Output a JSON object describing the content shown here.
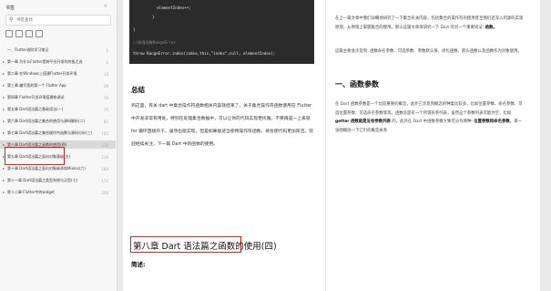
{
  "sidebar": {
    "title": "书签",
    "close": "×",
    "search_placeholder": "书签查找",
    "items": [
      {
        "label": "一、Flutter进阶学习笔记",
        "page": "1"
      },
      {
        "label": "第一章 为什么Flutter是跨平台开发的终极之选",
        "page": "2"
      },
      {
        "label": "第二章 在Windows上搭建Flutter开发环境",
        "page": "13"
      },
      {
        "label": "第三章 编写您的第一个 Flutter App",
        "page": "28"
      },
      {
        "label": "第四章 Flutter开发环境搭建和调试",
        "page": "70"
      },
      {
        "label": "第五章 Dart语法篇之基础语法(一)",
        "page": "75"
      },
      {
        "label": "第六章 Dart语法篇之集合的使用与源码解析(二)",
        "page": "82"
      },
      {
        "label": "第七章 Dart语法篇之集合操作符函数与源码分析(三)",
        "page": "105"
      },
      {
        "label": "第八章 Dart语法篇之函数的使用(四)",
        "page": "128"
      },
      {
        "label": "第九章 Dart语法篇之面向对象基础(五)",
        "page": "139"
      },
      {
        "label": "第十章 Dart语法篇之面向对象继承和Mixins(六)",
        "page": "160"
      },
      {
        "label": "第十一章 Dart语法篇之类型系统与泛型(七)",
        "page": "172"
      },
      {
        "label": "第十二章 Flutter中的widget",
        "page": "200"
      }
    ]
  },
  "code": {
    "line1": "    elementIndex++;",
    "line2": "  }",
    "line3": "}",
    "line4": "//调用函数RangeError",
    "line5": "throw RangeError.index(index,this,\"index\",null, elementIndex);"
  },
  "left_page": {
    "summary_heading": "总结",
    "summary_text": "到这里，有关 dart 中集合操作符函数相关内容就结束了，关于集合操作符函数使用在 Flutter 中开发非常有用处，特别在处理集合数据中，可以让你的代码实现更优雅，不要再是一上来就 for 循环直接开干，虽然也能实现，但是如果能适当使用操作符函数，将会使代码更加简洁。欢迎继续关注，下一篇 Dart 中的函数的使用。",
    "chapter_title": "第八章 Dart 语法篇之函数的使用(四)",
    "brief_heading": "简述:"
  },
  "right_page": {
    "para1": "在上一篇文章中我们详细地研究了一下集合有关内容，包括集合的操作符的使用甚至我们还深入到源码实现原理，从原理上掌握集合的使用。那么这篇文章来研究一下 Dart 的另一个重要语法: ",
    "para1_bold": "函数。",
    "para2": "这篇主要会涉及到: 函数命名参数、可选参数、参数默认值、闭包函数、箭头函数以及函数作为对象使用。",
    "section_heading": "一、函数参数",
    "para3": "在 Dart 函数参数是一个比较重要的概念，此外它涉及到概念的种类比较多，比如位置参数、命名参数、可选位置参数、可选命名参数等等。函数总是有一个所谓形参列表，虽然这个参数列表可能为空，比如 ",
    "para3_bold": "getter 函数就是没有参数列表",
    "para3_end": " 的。此外在 Dart 中函数参数大致可分为两种: ",
    "para3_bold2": "位置参数和命名参数",
    "para3_tail": "。来一张图概括一下它们的概念关系"
  }
}
